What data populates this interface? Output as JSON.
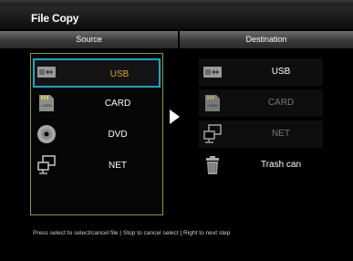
{
  "window": {
    "title": "File Copy"
  },
  "columns": {
    "source": "Source",
    "destination": "Destination"
  },
  "source_items": [
    {
      "label": "USB",
      "icon": "usb-icon",
      "selected": true
    },
    {
      "label": "CARD",
      "icon": "card-icon",
      "selected": false
    },
    {
      "label": "DVD",
      "icon": "dvd-icon",
      "selected": false
    },
    {
      "label": "NET",
      "icon": "network-icon",
      "selected": false
    }
  ],
  "destination_items": [
    {
      "label": "USB",
      "icon": "usb-icon",
      "enabled": true
    },
    {
      "label": "CARD",
      "icon": "card-icon",
      "enabled": false
    },
    {
      "label": "NET",
      "icon": "network-icon",
      "enabled": false
    },
    {
      "label": "Trash can",
      "icon": "trash-icon",
      "enabled": true
    }
  ],
  "footer": {
    "hint": "Press select to select/cancel file | Stop to cancel select | Right to next step"
  },
  "colors": {
    "selection_border": "#17a6c6",
    "selected_text": "#e8a21a",
    "panel_border": "#8a9a3a"
  }
}
